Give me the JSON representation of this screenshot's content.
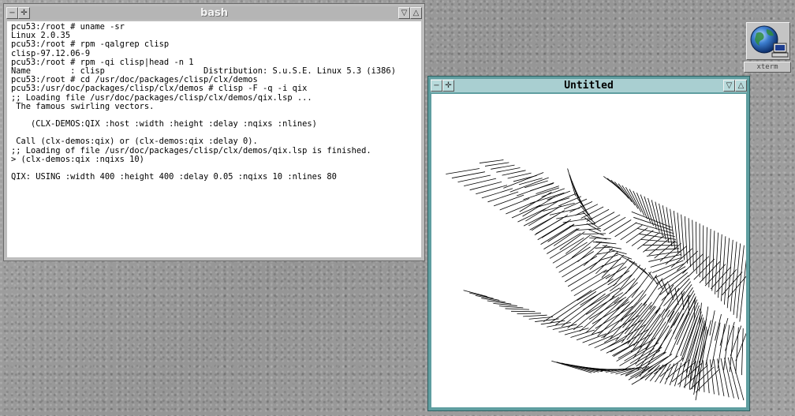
{
  "bash_window": {
    "title": "bash",
    "terminal_lines": [
      "pcu53:/root # uname -sr",
      "Linux 2.0.35",
      "pcu53:/root # rpm -qalgrep clisp",
      "clisp-97.12.06-9",
      "pcu53:/root # rpm -qi clisp|head -n 1",
      "Name        : clisp                    Distribution: S.u.S.E. Linux 5.3 (i386)",
      "pcu53:/root # cd /usr/doc/packages/clisp/clx/demos",
      "pcu53:/usr/doc/packages/clisp/clx/demos # clisp -F -q -i qix",
      ";; Loading file /usr/doc/packages/clisp/clx/demos/qix.lsp ...",
      " The famous swirling vectors.",
      "",
      "    (CLX-DEMOS:QIX :host :width :height :delay :nqixs :nlines)",
      "",
      " Call (clx-demos:qix) or (clx-demos:qix :delay 0).",
      ";; Loading of file /usr/doc/packages/clisp/clx/demos/qix.lsp is finished.",
      "> (clx-demos:qix :nqixs 10)",
      "",
      "QIX: USING :width 400 :height 400 :delay 0.05 :nqixs 10 :nlines 80"
    ]
  },
  "qix_window": {
    "title": "Untitled"
  },
  "desktop_icon": {
    "label": "xterm",
    "icon": "globe-computer-icon"
  },
  "window_buttons": {
    "menu_glyph": "−",
    "move_glyph": "✛",
    "iconify_glyph": "▽",
    "maximize_glyph": "△"
  },
  "colors": {
    "bash_frame": "#bdbdbd",
    "qix_frame": "#5f9ea0",
    "qix_lines": "#000000"
  }
}
